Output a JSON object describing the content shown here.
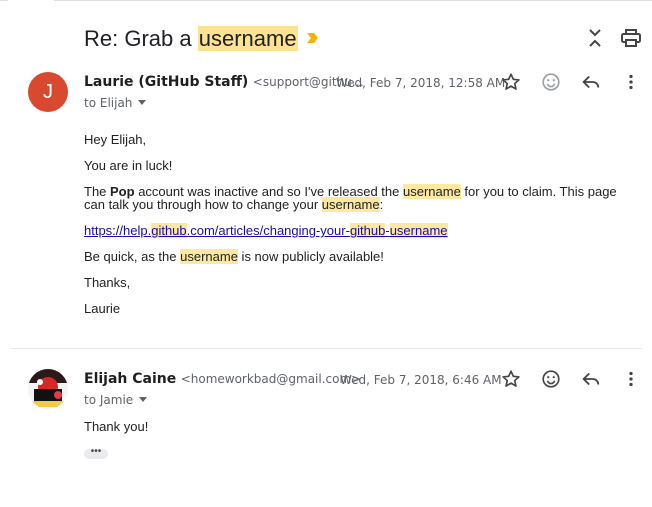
{
  "thread": {
    "subject_prefix": "Re: Grab a ",
    "subject_highlight": "username"
  },
  "messages": [
    {
      "avatar_letter": "J",
      "sender_name": "Laurie (GitHub Staff)",
      "sender_email": "<support@githu…",
      "date": "Wed, Feb 7, 2018, 12:58 AM",
      "to_label": "to Elijah",
      "body": {
        "greeting": "Hey Elijah,",
        "line1": "You are in luck!",
        "p2_a": "The ",
        "p2_bold": "Pop",
        "p2_b": " account was inactive and so I've released the ",
        "p2_hl1": "username",
        "p2_c": " for you to claim. This page can talk you through how to change your ",
        "p2_hl2": "username",
        "p2_d": ":",
        "link_a": "https://help.",
        "link_hl1": "github",
        "link_b": ".com/articles/changing-your-",
        "link_hl2": "github",
        "link_c": "-",
        "link_hl3": "username",
        "p4_a": "Be quick, as the ",
        "p4_hl": "username",
        "p4_b": " is now publicly available!",
        "thanks": "Thanks,",
        "signoff": "Laurie"
      }
    },
    {
      "sender_name": "Elijah Caine",
      "sender_email": "<homeworkbad@gmail.com>",
      "date": "Wed, Feb 7, 2018, 6:46 AM",
      "to_label": "to Jamie",
      "body": {
        "text": "Thank you!"
      },
      "collapsed_label": "•••"
    }
  ],
  "icons": {
    "important_marker": "label-important-icon",
    "collapse_all": "unfold-less-icon",
    "print": "print-icon",
    "star": "star-outline-icon",
    "emoji": "add-reaction-icon",
    "reply": "reply-icon",
    "more": "more-vert-icon"
  },
  "colors": {
    "highlight": "#fde293",
    "important_marker": "#f4b400",
    "link": "#1a0dab",
    "avatar_j": "#d9492f"
  }
}
